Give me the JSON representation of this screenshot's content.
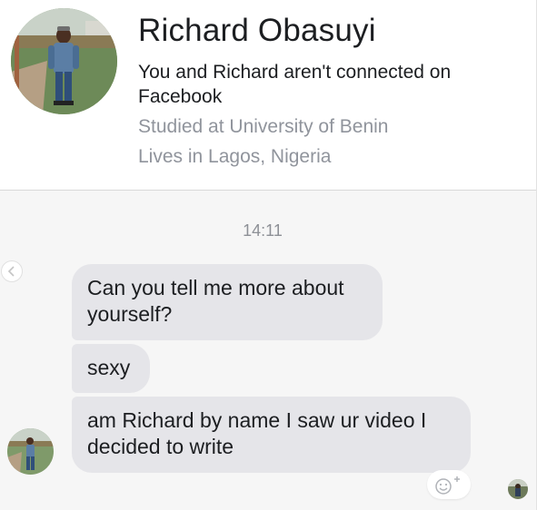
{
  "profile": {
    "name": "Richard Obasuyi",
    "connection_status": "You and Richard aren't connected on Facebook",
    "education": "Studied at University of Benin",
    "location": "Lives in Lagos, Nigeria"
  },
  "conversation": {
    "timestamp": "14:11",
    "messages": [
      {
        "sender": "Richard Obasuyi",
        "text": "Can you tell me more about yourself?"
      },
      {
        "sender": "Richard Obasuyi",
        "text": "sexy"
      },
      {
        "sender": "Richard Obasuyi",
        "text": "am Richard by name I saw ur video I decided to write"
      }
    ]
  },
  "icons": {
    "back": "chevron-left-icon",
    "react": "add-reaction-icon",
    "seen": "seen-avatar"
  },
  "colors": {
    "incoming_bubble": "#e5e5e9",
    "name_text": "#1c1e21",
    "meta_text": "#90949c",
    "thread_background": "#f6f6f6"
  }
}
